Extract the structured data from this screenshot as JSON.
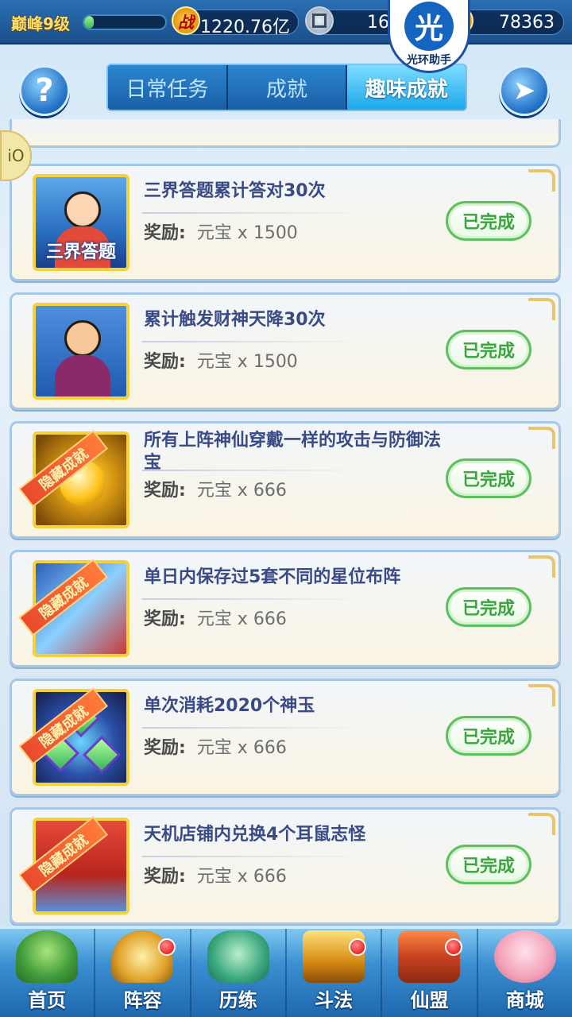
{
  "status_bar": {
    "level": "巅峰9级",
    "exp_fraction": 0.12,
    "combat_power": "1220.76亿",
    "coins": "16",
    "gold": "78363"
  },
  "watermark": {
    "glyph": "光",
    "text": "光环助手"
  },
  "tabs": [
    {
      "label": "日常任务",
      "active": false
    },
    {
      "label": "成就",
      "active": false
    },
    {
      "label": "趣味成就",
      "active": true
    }
  ],
  "side_button": {
    "glyph": "iO"
  },
  "hidden_ribbon_label": "隐藏成就",
  "done_label": "已完成",
  "reward_label": "奖励:",
  "achievements": [
    {
      "title": "三界答题累计答对30次",
      "reward": "元宝 x 1500",
      "hidden": false,
      "thumb_caption": "三界答题"
    },
    {
      "title": "累计触发财神天降30次",
      "reward": "元宝 x 1500",
      "hidden": false,
      "thumb_caption": ""
    },
    {
      "title": "所有上阵神仙穿戴一样的攻击与防御法宝",
      "reward": "元宝 x 666",
      "hidden": true,
      "thumb_caption": ""
    },
    {
      "title": "单日内保存过5套不同的星位布阵",
      "reward": "元宝 x 666",
      "hidden": true,
      "thumb_caption": ""
    },
    {
      "title": "单次消耗2020个神玉",
      "reward": "元宝 x 666",
      "hidden": true,
      "thumb_caption": ""
    },
    {
      "title": "天机店铺内兑换4个耳鼠志怪",
      "reward": "元宝 x 666",
      "hidden": true,
      "thumb_caption": ""
    }
  ],
  "bottom_nav": [
    {
      "label": "首页",
      "icon": "home-island-icon",
      "badge": false
    },
    {
      "label": "阵容",
      "icon": "lineup-altar-icon",
      "badge": true
    },
    {
      "label": "历练",
      "icon": "gourd-icon",
      "badge": false
    },
    {
      "label": "斗法",
      "icon": "sword-icon",
      "badge": true
    },
    {
      "label": "仙盟",
      "icon": "palace-icon",
      "badge": true
    },
    {
      "label": "商城",
      "icon": "shop-girl-icon",
      "badge": false
    }
  ]
}
